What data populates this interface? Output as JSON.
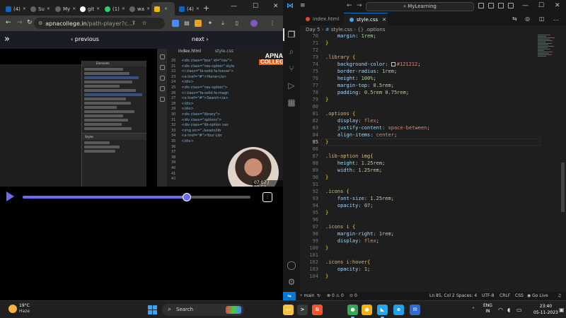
{
  "browser": {
    "tabs": [
      {
        "label": "(4)",
        "favicon": "linkedin-icon"
      },
      {
        "label": "Su",
        "favicon": "generic-icon"
      },
      {
        "label": "My",
        "favicon": "generic-icon"
      },
      {
        "label": "git",
        "favicon": "github-icon"
      },
      {
        "label": "(1)",
        "favicon": "whatsapp-icon"
      },
      {
        "label": "wa",
        "favicon": "generic-icon"
      },
      {
        "label": "",
        "favicon": "apna-college-icon"
      },
      {
        "label": "(4)",
        "favicon": "linkedin-icon"
      }
    ],
    "active_tab": 6,
    "url_host": "apnacollege.in",
    "url_path": "/path-player?c...",
    "player": {
      "prev_label": "previous",
      "next_label": "next",
      "progress": 0.72,
      "video_time": "07:07 / 09:52",
      "logo_line1": "APNA",
      "logo_line2": "COLLEGE",
      "devtools_tab": "Elements",
      "devtools_styles_tab": "Styles",
      "inner_file": "index.html",
      "inner_file2": "style.css",
      "inner_lines": [
        "20",
        "21",
        "22",
        "23",
        "24",
        "25",
        "26",
        "27",
        "28",
        "29",
        "30",
        "31",
        "32",
        "33",
        "34",
        "35",
        "36",
        "37",
        "38",
        "39",
        "40",
        "41",
        "42"
      ],
      "inner_code": [
        "<div class=\"box\" id=\"nav\">",
        "<div class=\"nav-option\" style",
        "<i class=\"fa-solid fa-house\">",
        "<a href=\"#\">Home</a>",
        "</div>",
        "<div class=\"nav-option\">",
        "<i class=\"fa-solid fa-magn",
        "<a href=\"#\">Search</a>",
        "</div>",
        "</div>",
        "<div class=\"library\">",
        "<div class=\"options\">",
        "<div class=\"lib-option nav",
        "<img src=\"./assets/lib",
        "<a href=\"#\">Your Libr",
        "</div>",
        "",
        "",
        "",
        "",
        "",
        "",
        ""
      ]
    }
  },
  "vscode": {
    "menu_icon": "hamburger-icon",
    "search_text": "MyLearning",
    "tabs": [
      {
        "label": "index.html",
        "color": "#e44d26"
      },
      {
        "label": "style.css",
        "color": "#42a5f5"
      }
    ],
    "active_tab": 1,
    "breadcrumb": [
      "Day 5",
      "style.css",
      ".options"
    ],
    "current_line": "85",
    "lines": [
      {
        "n": "70",
        "code": "    margin: 1rem;",
        "type": "decl"
      },
      {
        "n": "71",
        "code": "}",
        "type": "brace"
      },
      {
        "n": "72",
        "code": "",
        "type": "blank"
      },
      {
        "n": "73",
        "code": ".library {",
        "type": "selector"
      },
      {
        "n": "74",
        "code": "    background-color: #121212;",
        "type": "color-decl"
      },
      {
        "n": "75",
        "code": "    border-radius: 1rem;",
        "type": "decl"
      },
      {
        "n": "76",
        "code": "    height: 100%;",
        "type": "decl"
      },
      {
        "n": "77",
        "code": "    margin-top: 0.5rem;",
        "type": "decl"
      },
      {
        "n": "78",
        "code": "    padding: 0.5rem 0.75rem;",
        "type": "decl"
      },
      {
        "n": "79",
        "code": "}",
        "type": "brace"
      },
      {
        "n": "80",
        "code": "",
        "type": "blank"
      },
      {
        "n": "81",
        "code": ".options {",
        "type": "selector"
      },
      {
        "n": "82",
        "code": "    display: flex;",
        "type": "decl"
      },
      {
        "n": "83",
        "code": "    justify-content: space-between;",
        "type": "decl"
      },
      {
        "n": "84",
        "code": "    align-items: center;",
        "type": "decl"
      },
      {
        "n": "85",
        "code": "}",
        "type": "brace"
      },
      {
        "n": "86",
        "code": "",
        "type": "blank"
      },
      {
        "n": "87",
        "code": ".lib-option img{",
        "type": "selector"
      },
      {
        "n": "88",
        "code": "    height: 1.25rem;",
        "type": "decl"
      },
      {
        "n": "89",
        "code": "    width: 1.25rem;",
        "type": "decl"
      },
      {
        "n": "90",
        "code": "}",
        "type": "brace"
      },
      {
        "n": "91",
        "code": "",
        "type": "blank"
      },
      {
        "n": "92",
        "code": ".icons {",
        "type": "selector"
      },
      {
        "n": "93",
        "code": "    font-size: 1.25rem;",
        "type": "decl"
      },
      {
        "n": "94",
        "code": "    opacity: 07;",
        "type": "decl"
      },
      {
        "n": "95",
        "code": "}",
        "type": "brace"
      },
      {
        "n": "96",
        "code": "",
        "type": "blank"
      },
      {
        "n": "97",
        "code": ".icons i {",
        "type": "selector"
      },
      {
        "n": "98",
        "code": "    margin-right: 1rem;",
        "type": "decl"
      },
      {
        "n": "99",
        "code": "    display: flex;",
        "type": "decl"
      },
      {
        "n": "100",
        "code": "}",
        "type": "brace"
      },
      {
        "n": "101",
        "code": "",
        "type": "blank"
      },
      {
        "n": "102",
        "code": ".icons i:hover{",
        "type": "selector"
      },
      {
        "n": "103",
        "code": "    opacity: 1;",
        "type": "decl"
      },
      {
        "n": "104",
        "code": "}",
        "type": "brace"
      }
    ],
    "status": {
      "branch": "main",
      "errors": "0",
      "warnings": "0",
      "info": "0",
      "position": "Ln 85, Col 2",
      "spaces": "Spaces: 4",
      "encoding": "UTF-8",
      "eol": "CRLF",
      "language": "CSS",
      "golive": "Go Live"
    }
  },
  "taskbar": {
    "temperature": "19°C",
    "condition": "Haze",
    "search_label": "Search",
    "lang_line1": "ENG",
    "lang_line2": "IN",
    "time": "23:40",
    "date": "05-11-2023",
    "apps": [
      {
        "name": "file-explorer-icon",
        "color": "#f6c343",
        "glyph": "▭"
      },
      {
        "name": "terminal-icon",
        "color": "#3a3a3a",
        "glyph": ">"
      },
      {
        "name": "brave-icon",
        "color": "#fb542b",
        "glyph": "B"
      },
      {
        "name": "chrome-icon",
        "color": "#34a853",
        "glyph": "●"
      },
      {
        "name": "chrome-canary-icon",
        "color": "#f4b400",
        "glyph": "●"
      },
      {
        "name": "vscode-icon",
        "color": "#23a9f2",
        "glyph": "◣"
      },
      {
        "name": "edge-icon",
        "color": "#1fa0e8",
        "glyph": "e"
      },
      {
        "name": "mail-icon",
        "color": "#2f6bd6",
        "glyph": "✉"
      }
    ]
  }
}
